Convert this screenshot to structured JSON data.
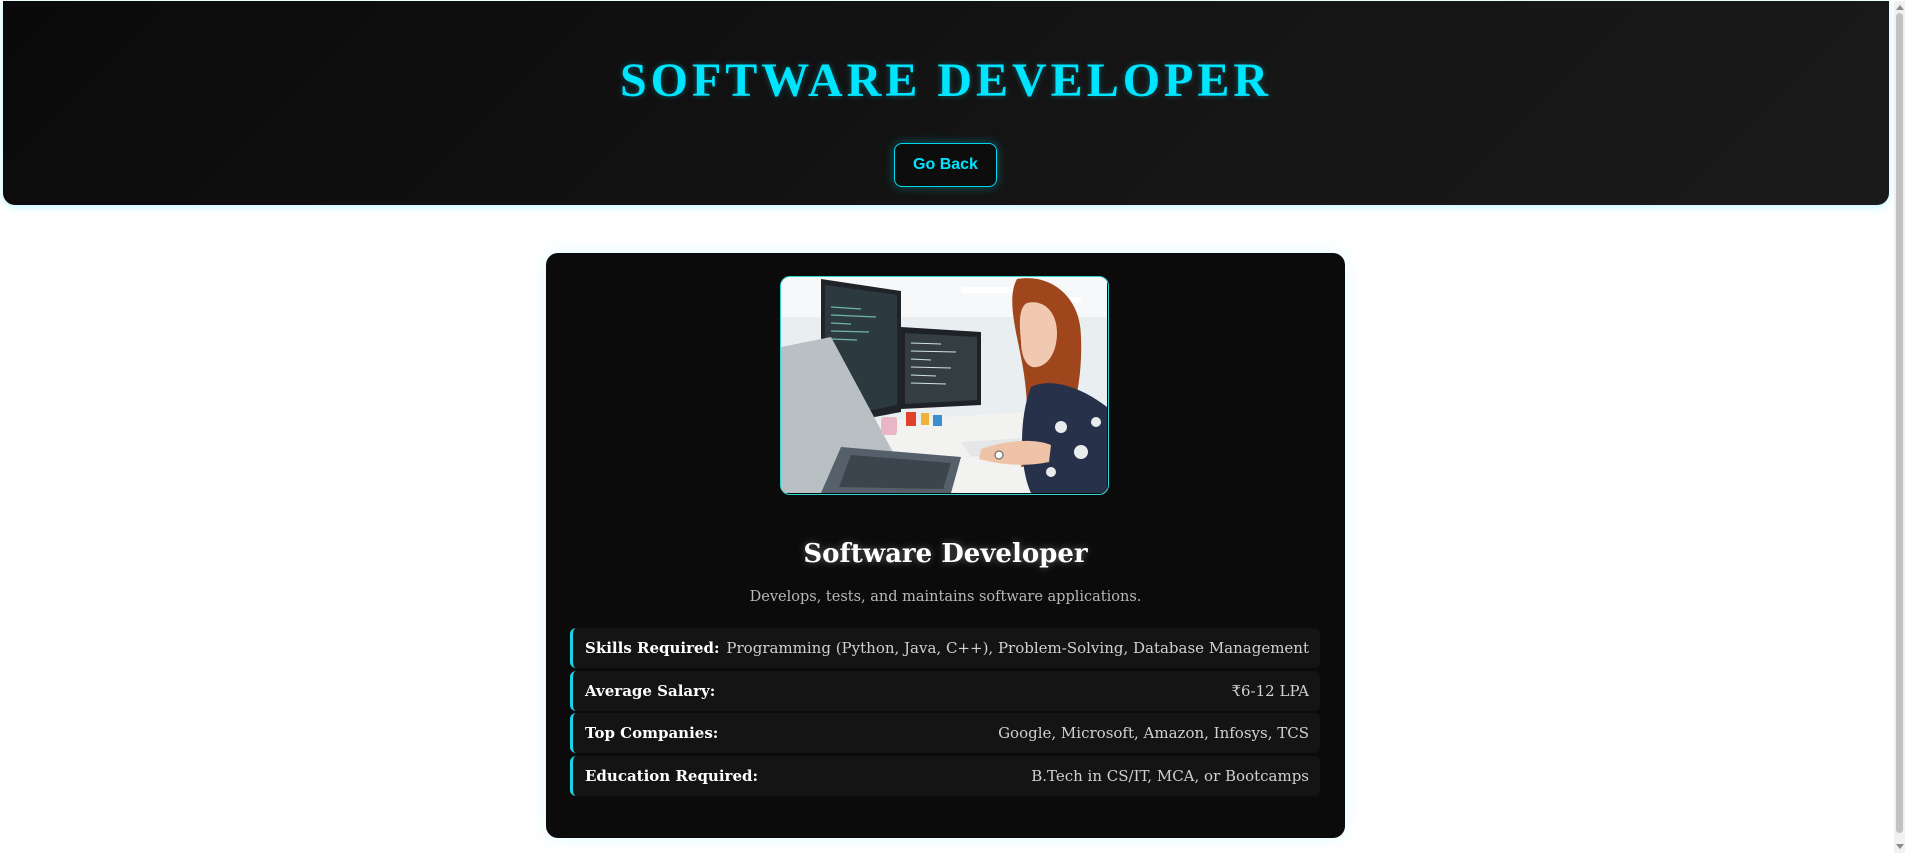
{
  "header": {
    "title": "SOFTWARE DEVELOPER",
    "back_label": "Go Back"
  },
  "card": {
    "image_alt": "Software developer working at computer monitors",
    "title": "Software Developer",
    "description": "Develops, tests, and maintains software applications.",
    "details": [
      {
        "label": "Skills Required:",
        "value": "Programming (Python, Java, C++), Problem-Solving, Database Management"
      },
      {
        "label": "Average Salary:",
        "value": "₹6-12 LPA"
      },
      {
        "label": "Top Companies:",
        "value": "Google, Microsoft, Amazon, Infosys, TCS"
      },
      {
        "label": "Education Required:",
        "value": "B.Tech in CS/IT, MCA, or Bootcamps"
      }
    ]
  },
  "colors": {
    "accent": "#00e5ff",
    "header_bg": "#0a0a0a",
    "card_bg": "#0b0b0b",
    "row_bg": "#141414"
  }
}
